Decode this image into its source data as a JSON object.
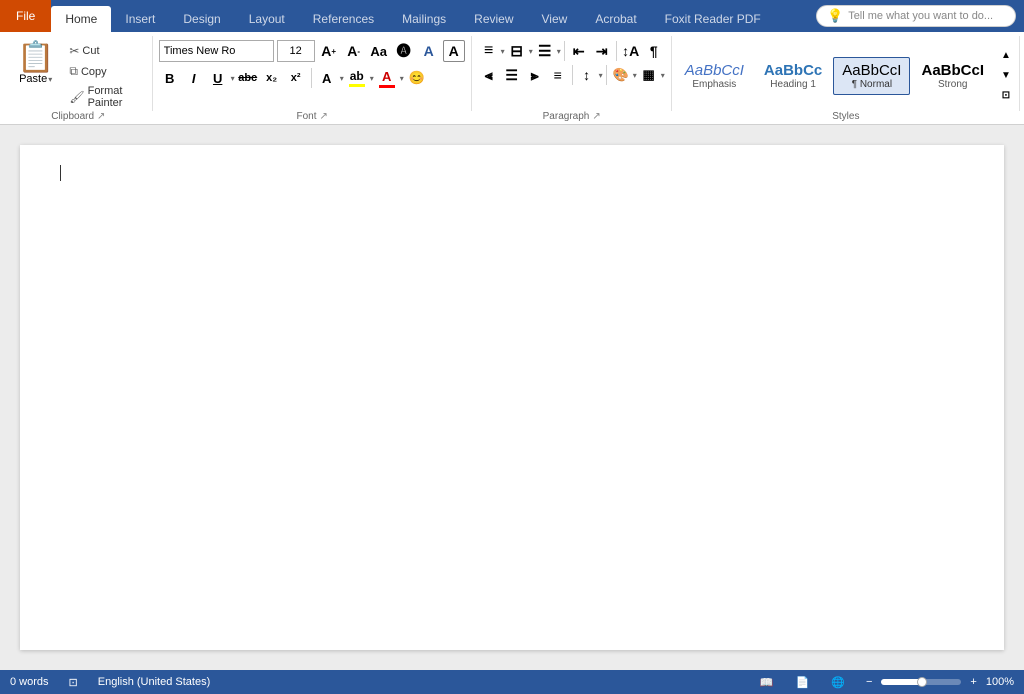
{
  "tabs": [
    {
      "id": "file",
      "label": "File"
    },
    {
      "id": "home",
      "label": "Home",
      "active": true
    },
    {
      "id": "insert",
      "label": "Insert"
    },
    {
      "id": "design",
      "label": "Design"
    },
    {
      "id": "layout",
      "label": "Layout"
    },
    {
      "id": "references",
      "label": "References"
    },
    {
      "id": "mailings",
      "label": "Mailings"
    },
    {
      "id": "review",
      "label": "Review"
    },
    {
      "id": "view",
      "label": "View"
    },
    {
      "id": "acrobat",
      "label": "Acrobat"
    },
    {
      "id": "foxit",
      "label": "Foxit Reader PDF"
    }
  ],
  "tell_me": "Tell me what you want to do...",
  "clipboard": {
    "paste_label": "Paste",
    "cut_label": "Cut",
    "copy_label": "Copy",
    "format_painter_label": "Format Painter",
    "group_label": "Clipboard"
  },
  "font": {
    "name": "Times New Ro",
    "size": "12",
    "group_label": "Font",
    "bold": "B",
    "italic": "I",
    "underline": "U",
    "strikethrough": "abc",
    "subscript": "x₂",
    "superscript": "x²"
  },
  "paragraph": {
    "group_label": "Paragraph"
  },
  "styles": {
    "group_label": "Styles",
    "items": [
      {
        "id": "emphasis",
        "preview": "AaBbCcI",
        "label": "Emphasis",
        "style": "italic"
      },
      {
        "id": "heading1",
        "preview": "AaBbCc",
        "label": "Heading 1",
        "style": "heading"
      },
      {
        "id": "normal",
        "preview": "AaBbCcI",
        "label": "¶ Normal",
        "selected": true
      },
      {
        "id": "strong",
        "preview": "AaBbCcI",
        "label": "Strong",
        "style": "bold"
      }
    ]
  },
  "status_bar": {
    "word_count": "0 words",
    "language": "English (United States)"
  }
}
